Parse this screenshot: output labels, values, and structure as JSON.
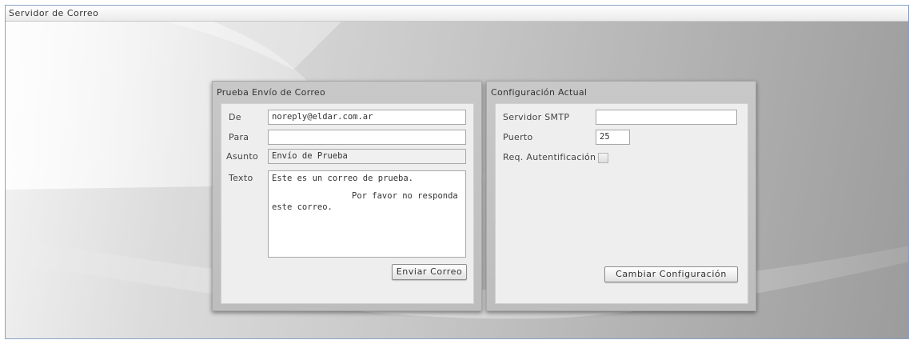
{
  "window": {
    "title": "Servidor de Correo"
  },
  "send_panel": {
    "title": "Prueba Envío de Correo",
    "from_label": "De",
    "from_value": "noreply@eldar.com.ar",
    "to_label": "Para",
    "to_value": "",
    "subject_label": "Asunto",
    "subject_value": "Envío de Prueba",
    "body_label": "Texto",
    "body_lines": [
      "Este es un correo de prueba.",
      "Por favor no responda",
      "este correo."
    ],
    "send_button": "Enviar Correo"
  },
  "config_panel": {
    "title": "Configuración Actual",
    "smtp_label": "Servidor SMTP",
    "smtp_value": "",
    "port_label": "Puerto",
    "port_value": "25",
    "auth_label": "Req. Autentificación",
    "auth_checked": false,
    "change_button": "Cambiar Configuración"
  },
  "colors": {
    "window_border": "#8ba3c6",
    "panel_frame": "#c2c2c2",
    "panel_body": "#eeeeee"
  }
}
